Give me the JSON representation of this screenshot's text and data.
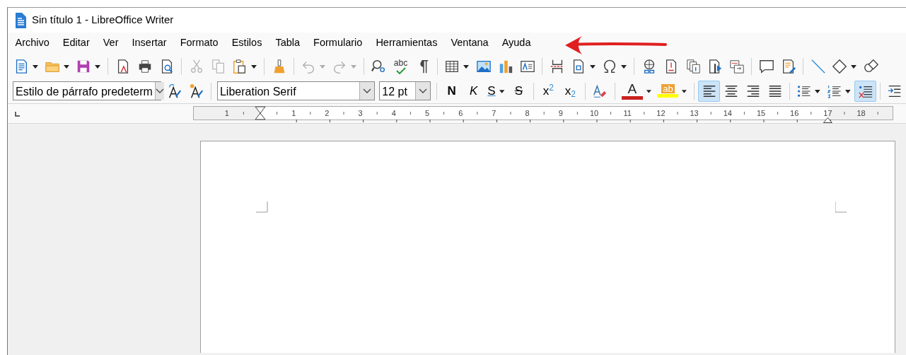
{
  "window": {
    "title": "Sin título 1 - LibreOffice Writer"
  },
  "menu": [
    {
      "label": "Archivo"
    },
    {
      "label": "Editar"
    },
    {
      "label": "Ver"
    },
    {
      "label": "Insertar"
    },
    {
      "label": "Formato"
    },
    {
      "label": "Estilos"
    },
    {
      "label": "Tabla"
    },
    {
      "label": "Formulario"
    },
    {
      "label": "Herramientas"
    },
    {
      "label": "Ventana"
    },
    {
      "label": "Ayuda"
    }
  ],
  "standard_toolbar": [
    {
      "kind": "icon",
      "dropdown": true,
      "disabled": false
    },
    {
      "kind": "icon",
      "dropdown": true,
      "disabled": false
    },
    {
      "kind": "icon",
      "dropdown": true,
      "disabled": false
    },
    {
      "kind": "separator"
    },
    {
      "kind": "icon",
      "dropdown": false,
      "disabled": false
    },
    {
      "kind": "icon",
      "dropdown": false,
      "disabled": false
    },
    {
      "kind": "icon",
      "dropdown": false,
      "disabled": false
    },
    {
      "kind": "separator"
    },
    {
      "kind": "icon",
      "dropdown": false,
      "disabled": true
    },
    {
      "kind": "icon",
      "dropdown": false,
      "disabled": true
    },
    {
      "kind": "icon",
      "dropdown": true,
      "disabled": false
    },
    {
      "kind": "separator"
    },
    {
      "kind": "icon",
      "dropdown": false,
      "disabled": false
    },
    {
      "kind": "separator"
    },
    {
      "kind": "icon",
      "dropdown": true,
      "disabled": true
    },
    {
      "kind": "icon",
      "dropdown": true,
      "disabled": true
    },
    {
      "kind": "separator"
    },
    {
      "kind": "icon",
      "dropdown": false,
      "disabled": false
    },
    {
      "kind": "icon",
      "dropdown": false,
      "disabled": false,
      "label": "abc"
    },
    {
      "kind": "icon",
      "dropdown": false,
      "disabled": false
    },
    {
      "kind": "separator"
    },
    {
      "kind": "icon",
      "dropdown": true,
      "disabled": false
    },
    {
      "kind": "icon",
      "dropdown": false,
      "disabled": false
    },
    {
      "kind": "icon",
      "dropdown": false,
      "disabled": false
    },
    {
      "kind": "icon",
      "dropdown": false,
      "disabled": false
    },
    {
      "kind": "separator"
    },
    {
      "kind": "icon",
      "dropdown": false,
      "disabled": false
    },
    {
      "kind": "icon",
      "dropdown": true,
      "disabled": false
    },
    {
      "kind": "icon",
      "dropdown": true,
      "disabled": false
    },
    {
      "kind": "separator"
    },
    {
      "kind": "icon",
      "dropdown": false,
      "disabled": false
    },
    {
      "kind": "icon",
      "dropdown": false,
      "disabled": false
    },
    {
      "kind": "icon",
      "dropdown": false,
      "disabled": false
    },
    {
      "kind": "icon",
      "dropdown": false,
      "disabled": false
    },
    {
      "kind": "icon",
      "dropdown": false,
      "disabled": false
    },
    {
      "kind": "separator"
    },
    {
      "kind": "icon",
      "dropdown": false,
      "disabled": false
    },
    {
      "kind": "icon",
      "dropdown": false,
      "disabled": false
    },
    {
      "kind": "separator"
    },
    {
      "kind": "icon",
      "dropdown": false,
      "disabled": false
    },
    {
      "kind": "icon",
      "dropdown": true,
      "disabled": false
    },
    {
      "kind": "icon",
      "dropdown": false,
      "disabled": false
    }
  ],
  "formatting_toolbar": [
    {
      "kind": "combo",
      "value": "Estilo de párrafo predeterm"
    },
    {
      "kind": "icon",
      "dropdown": false,
      "selected": false
    },
    {
      "kind": "icon",
      "dropdown": false,
      "selected": false
    },
    {
      "kind": "separator"
    },
    {
      "kind": "combo",
      "value": "Liberation Serif"
    },
    {
      "kind": "combo",
      "value": "12 pt"
    },
    {
      "kind": "separator"
    },
    {
      "kind": "letter",
      "label": "N",
      "dropdown": false,
      "selected": false
    },
    {
      "kind": "letter",
      "label": "K",
      "dropdown": false,
      "selected": false
    },
    {
      "kind": "letter",
      "label": "S",
      "dropdown": true,
      "selected": false
    },
    {
      "kind": "letter",
      "label": "S",
      "dropdown": false,
      "selected": false
    },
    {
      "kind": "separator"
    },
    {
      "kind": "letter",
      "label": "x$^{2}$",
      "dropdown": false,
      "selected": false
    },
    {
      "kind": "letter",
      "label": "x$_{2}$",
      "dropdown": false,
      "selected": false
    },
    {
      "kind": "separator"
    },
    {
      "kind": "icon",
      "dropdown": false,
      "selected": false
    },
    {
      "kind": "separator"
    },
    {
      "kind": "color",
      "label": "A",
      "color": "#c9211e",
      "dropdown": true,
      "selected": false
    },
    {
      "kind": "color",
      "label": "ab",
      "color": "#ffff00",
      "dropdown": true,
      "selected": false
    },
    {
      "kind": "separator"
    },
    {
      "kind": "icon",
      "dropdown": false,
      "selected": true
    },
    {
      "kind": "icon",
      "dropdown": false,
      "selected": false
    },
    {
      "kind": "icon",
      "dropdown": false,
      "selected": false
    },
    {
      "kind": "icon",
      "dropdown": false,
      "selected": false
    },
    {
      "kind": "separator"
    },
    {
      "kind": "icon",
      "dropdown": true,
      "selected": false
    },
    {
      "kind": "icon",
      "dropdown": true,
      "selected": false
    },
    {
      "kind": "icon",
      "dropdown": false,
      "selected": true
    },
    {
      "kind": "separator"
    },
    {
      "kind": "icon",
      "dropdown": false,
      "selected": false
    }
  ],
  "ruler": {
    "labels": [
      "1",
      "1",
      "2",
      "3",
      "4",
      "5",
      "6",
      "7",
      "8",
      "9",
      "10",
      "11",
      "12",
      "13",
      "14",
      "15",
      "16",
      "17",
      "18"
    ]
  }
}
